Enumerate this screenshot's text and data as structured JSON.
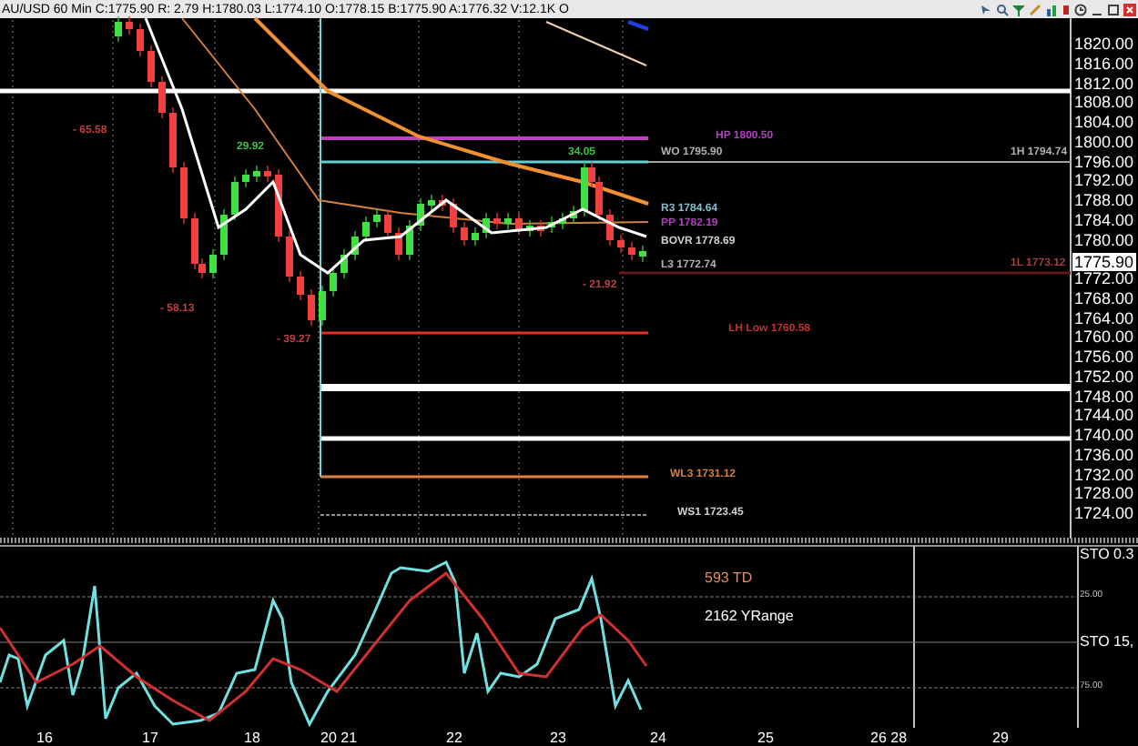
{
  "title_bar": {
    "text": "AU/USD 60 Min  C:1775.90  R: 2.79  H:1780.03  L:1774.10  O:1778.15  B:1775.90  A:1776.32  V:12.1K  O"
  },
  "price_axis": {
    "labels": [
      "1820.00",
      "1816.00",
      "1812.00",
      "1808.00",
      "1804.00",
      "1800.00",
      "1796.00",
      "1792.00",
      "1788.00",
      "1784.00",
      "1780.00",
      "1772.00",
      "1768.00",
      "1764.00",
      "1760.00",
      "1756.00",
      "1752.00",
      "1748.00",
      "1744.00",
      "1740.00",
      "1736.00",
      "1732.00",
      "1728.00",
      "1724.00"
    ],
    "current_price": "1775.90"
  },
  "level_labels": [
    {
      "text": "HP 1800.50",
      "color": "#b040c0"
    },
    {
      "text": "WO 1795.90",
      "color": "#b0b0b0"
    },
    {
      "text": "1H 1794.74",
      "color": "#b0b0b0"
    },
    {
      "text": "R3 1784.64",
      "color": "#80c0d0"
    },
    {
      "text": "PP 1782.19",
      "color": "#b040c0"
    },
    {
      "text": "BOVR 1778.69",
      "color": "#d0d0d0"
    },
    {
      "text": "L3 1772.74",
      "color": "#b0b0b0"
    },
    {
      "text": "1L 1773.12",
      "color": "#a04040"
    },
    {
      "text": "LH Low 1760.58",
      "color": "#c03030"
    },
    {
      "text": "WL3 1731.12",
      "color": "#d08040"
    },
    {
      "text": "WS1 1723.45",
      "color": "#d0d0d0"
    }
  ],
  "swing_labels": [
    {
      "text": "- 65.58",
      "color": "#c04040"
    },
    {
      "text": "29.92",
      "color": "#40c040"
    },
    {
      "text": "- 58.13",
      "color": "#c04040"
    },
    {
      "text": "- 39.27",
      "color": "#c04040"
    },
    {
      "text": "34.05",
      "color": "#40c040"
    },
    {
      "text": "- 21.92",
      "color": "#c04040"
    }
  ],
  "oscillator": {
    "texts": [
      {
        "text": "593 TD",
        "color": "#e09060"
      },
      {
        "text": "2162 YRange",
        "color": "#ffffff"
      }
    ],
    "axis_labels": [
      "25.00",
      "75.00"
    ],
    "name_labels": [
      "STO  0.3",
      "STO  15,"
    ]
  },
  "date_axis": {
    "labels": [
      "16",
      "17",
      "18",
      "20 21",
      "22",
      "23",
      "24",
      "25",
      "26  28",
      "29"
    ]
  }
}
